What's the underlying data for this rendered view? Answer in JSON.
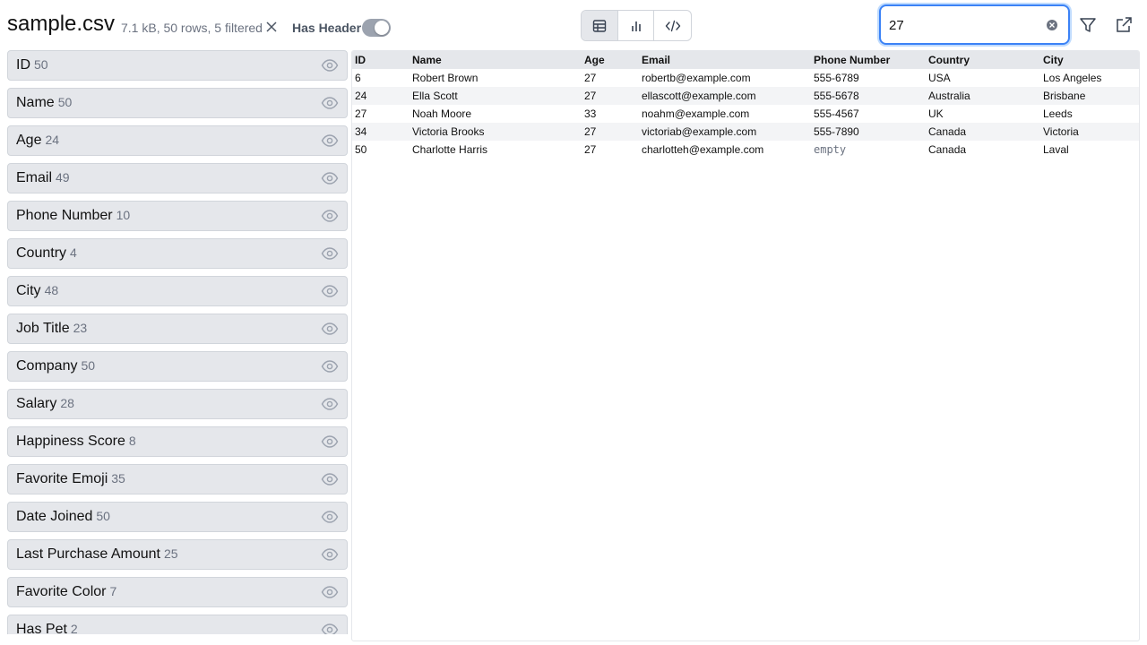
{
  "header": {
    "file_name": "sample.csv",
    "file_meta": "7.1 kB, 50 rows, 5 filtered",
    "has_header_label": "Has Header",
    "has_header_on": true,
    "view_modes": [
      "table",
      "chart",
      "code"
    ],
    "active_view": "table",
    "search": {
      "value": "27"
    }
  },
  "sidebar": {
    "columns": [
      {
        "name": "ID",
        "count": "50"
      },
      {
        "name": "Name",
        "count": "50"
      },
      {
        "name": "Age",
        "count": "24"
      },
      {
        "name": "Email",
        "count": "49"
      },
      {
        "name": "Phone Number",
        "count": "10"
      },
      {
        "name": "Country",
        "count": "4"
      },
      {
        "name": "City",
        "count": "48"
      },
      {
        "name": "Job Title",
        "count": "23"
      },
      {
        "name": "Company",
        "count": "50"
      },
      {
        "name": "Salary",
        "count": "28"
      },
      {
        "name": "Happiness Score",
        "count": "8"
      },
      {
        "name": "Favorite Emoji",
        "count": "35"
      },
      {
        "name": "Date Joined",
        "count": "50"
      },
      {
        "name": "Last Purchase Amount",
        "count": "25"
      },
      {
        "name": "Favorite Color",
        "count": "7"
      },
      {
        "name": "Has Pet",
        "count": "2"
      }
    ]
  },
  "table": {
    "headers": [
      "ID",
      "Name",
      "Age",
      "Email",
      "Phone Number",
      "Country",
      "City"
    ],
    "rows": [
      [
        "6",
        "Robert Brown",
        "27",
        "robertb@example.com",
        "555-6789",
        "USA",
        "Los Angeles"
      ],
      [
        "24",
        "Ella Scott",
        "27",
        "ellascott@example.com",
        "555-5678",
        "Australia",
        "Brisbane"
      ],
      [
        "27",
        "Noah Moore",
        "33",
        "noahm@example.com",
        "555-4567",
        "UK",
        "Leeds"
      ],
      [
        "34",
        "Victoria Brooks",
        "27",
        "victoriab@example.com",
        "555-7890",
        "Canada",
        "Victoria"
      ],
      [
        "50",
        "Charlotte Harris",
        "27",
        "charlotteh@example.com",
        "empty",
        "Canada",
        "Laval"
      ]
    ],
    "empty_value": "empty"
  },
  "colors": {
    "accent": "#3b82f6",
    "panel": "#e5e7eb",
    "muted_text": "#6b7280"
  }
}
